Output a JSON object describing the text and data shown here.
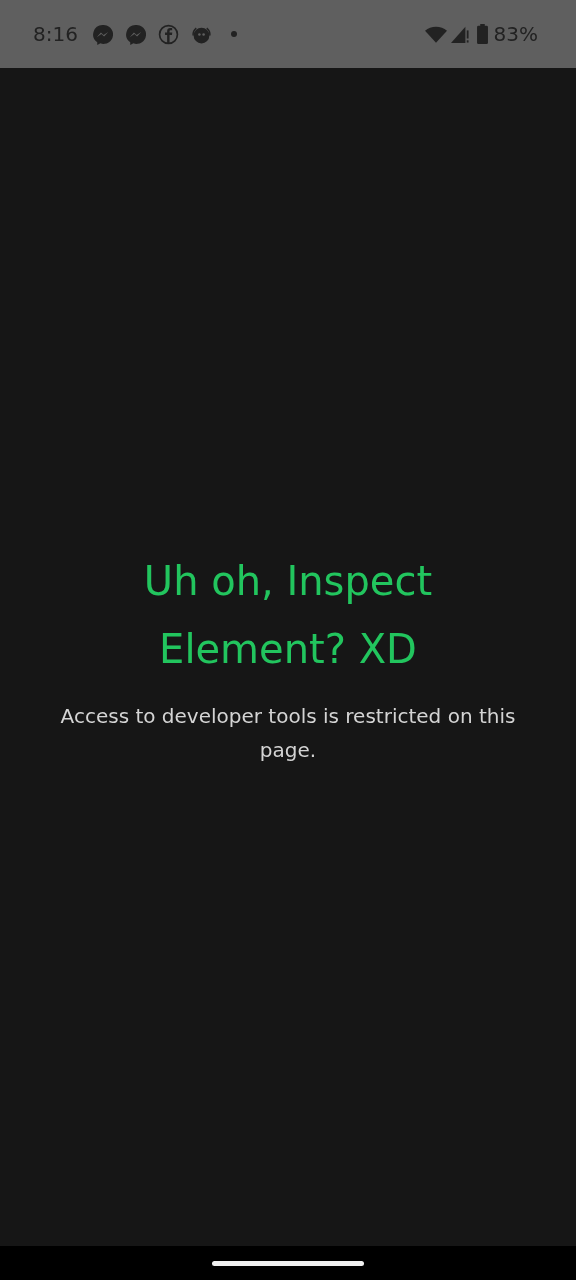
{
  "status_bar": {
    "time": "8:16",
    "battery": "83%"
  },
  "message": {
    "title": "Uh oh, Inspect Element? XD",
    "text": "Access to developer tools is restricted on this page."
  }
}
